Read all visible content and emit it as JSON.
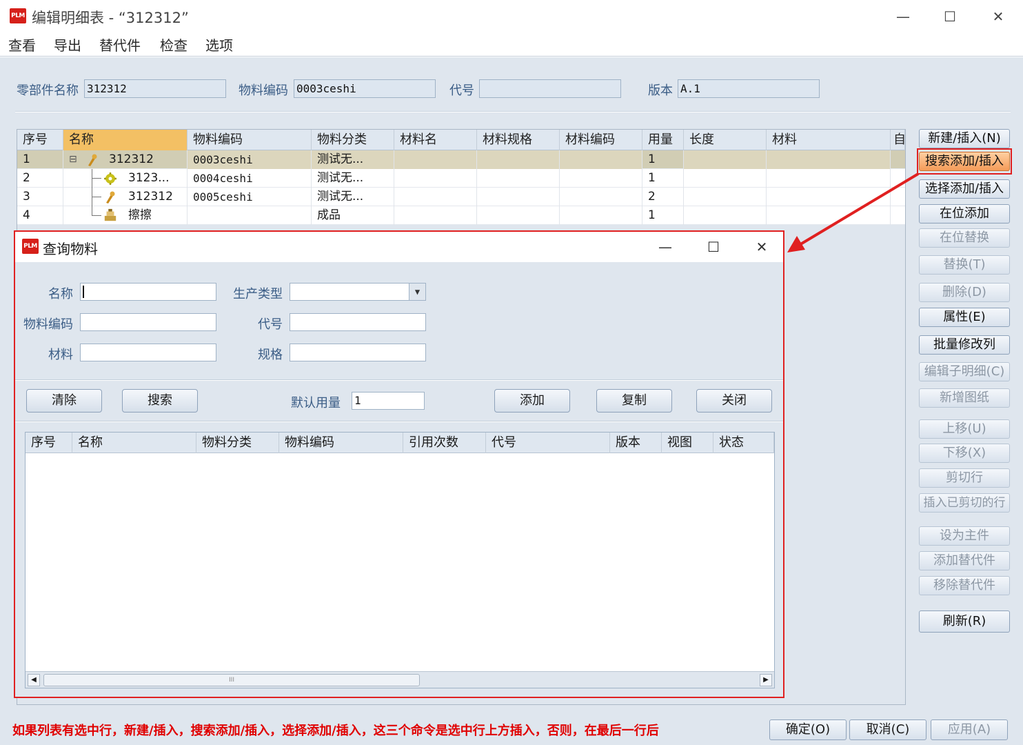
{
  "window": {
    "logo_text": "PLM",
    "title": "编辑明细表 - “312312”",
    "min_glyph": "—",
    "max_glyph": "☐",
    "close_glyph": "✕"
  },
  "menu": [
    "查看",
    "导出",
    "替代件",
    "检查",
    "选项"
  ],
  "header_form": {
    "part_name_label": "零部件名称",
    "part_name_value": "312312",
    "material_code_label": "物料编码",
    "material_code_value": "0003ceshi",
    "code_label": "代号",
    "code_value": "",
    "version_label": "版本",
    "version_value": "A.1"
  },
  "bom_table": {
    "columns": [
      "序号",
      "名称",
      "物料编码",
      "物料分类",
      "材料名",
      "材料规格",
      "材料编码",
      "用量",
      "长度",
      "材料",
      "自"
    ],
    "rows": [
      {
        "seq": "1",
        "name": "312312",
        "code": "0003ceshi",
        "category": "测试无...",
        "qty": "1",
        "icon": "part-icon",
        "expanded": "⊟"
      },
      {
        "seq": "2",
        "name": "3123...",
        "code": "0004ceshi",
        "category": "测试无...",
        "qty": "1",
        "icon": "gear-part-icon"
      },
      {
        "seq": "3",
        "name": "312312",
        "code": "0005ceshi",
        "category": "测试无...",
        "qty": "2",
        "icon": "part-icon"
      },
      {
        "seq": "4",
        "name": "擦擦",
        "code": "",
        "category": "成品",
        "qty": "1",
        "icon": "product-icon"
      }
    ],
    "scroll_right_glyph": "▶"
  },
  "side_buttons": {
    "new_insert": "新建/插入(N)",
    "search_add": "搜索添加/插入",
    "select_add": "选择添加/插入",
    "in_place_add": "在位添加",
    "in_place_replace": "在位替换",
    "replace": "替换(T)",
    "delete": "删除(D)",
    "properties": "属性(E)",
    "batch_edit": "批量修改列",
    "edit_sub": "编辑子明细(C)",
    "new_drawing": "新增图纸",
    "move_up": "上移(U)",
    "move_down": "下移(X)",
    "cut_row": "剪切行",
    "paste_cut": "插入已剪切的行",
    "set_main": "设为主件",
    "add_sub": "添加替代件",
    "remove_sub": "移除替代件",
    "refresh": "刷新(R)"
  },
  "bottom": {
    "note": "如果列表有选中行，新建/插入，搜索添加/插入，选择添加/插入，这三个命令是选中行上方插入，否则，在最后一行后",
    "ok": "确定(O)",
    "cancel": "取消(C)",
    "apply": "应用(A)"
  },
  "dialog": {
    "logo_text": "PLM",
    "title": "查询物料",
    "min_glyph": "—",
    "max_glyph": "☐",
    "close_glyph": "✕",
    "name_label": "名称",
    "name_value": "",
    "ptype_label": "生产类型",
    "ptype_value": "",
    "ptype_arrow": "▼",
    "mcode_label": "物料编码",
    "mcode_value": "",
    "code_label": "代号",
    "code_value": "",
    "material_label": "材料",
    "material_value": "",
    "spec_label": "规格",
    "spec_value": "",
    "clear_btn": "清除",
    "search_btn": "搜索",
    "qty_label": "默认用量",
    "qty_value": "1",
    "add_btn": "添加",
    "copy_btn": "复制",
    "close_btn": "关闭",
    "result_columns": [
      "序号",
      "名称",
      "物料分类",
      "物料编码",
      "引用次数",
      "代号",
      "版本",
      "视图",
      "状态"
    ],
    "scroll_left": "◀",
    "scroll_right": "▶",
    "scroll_thumb_grip": "III"
  },
  "colors": {
    "highlight_red": "#e02020",
    "sorted_header": "#f3c064",
    "selected_row": "#d1cdb4",
    "note_red": "#e00000",
    "label_blue": "#3b5d86"
  }
}
